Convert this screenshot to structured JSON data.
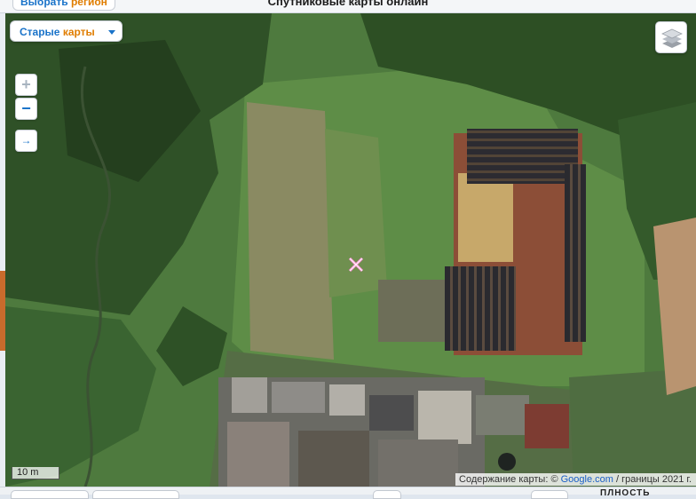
{
  "header": {
    "region_button": {
      "part1": "Выбрать",
      "part2": "регион"
    },
    "title": "Спутниковые карты онлайн"
  },
  "map_controls": {
    "style_select": {
      "part1": "Старые",
      "part2": "карты"
    },
    "zoom_in": "+",
    "zoom_out": "−",
    "pan": "→",
    "layers_icon": "layers-icon"
  },
  "scale": "10 m",
  "attribution": {
    "prefix": "Содержание карты: ©",
    "link": "Google.com",
    "suffix": "/ границы 2021 г."
  },
  "bottom": {
    "text": "ПЛНОСТЬ"
  },
  "colors": {
    "accent_blue": "#1a73c9",
    "accent_orange": "#e07d00",
    "imagery_green": "#4e7a3e"
  }
}
